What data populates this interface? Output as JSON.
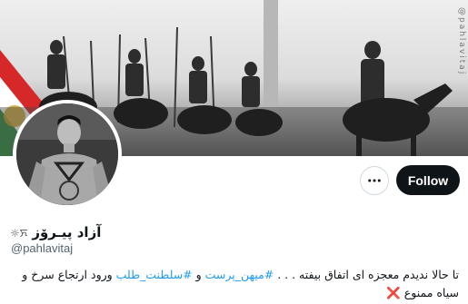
{
  "banner": {
    "watermark": "@pahlavitaj",
    "image_description_icon": "mounted-cavalry-parade-photo"
  },
  "profile": {
    "display_name": "آزاد پیـرۆز",
    "name_emoji": "☼ꯈ",
    "handle": "@pahlavitaj",
    "avatar_icon": "profile-photo"
  },
  "actions": {
    "more_icon": "more-horizontal-icon",
    "follow_label": "Follow"
  },
  "bio": {
    "text_before": "تا حالا ندیدم معجزه ای اتفاق بیفته . . . ",
    "hashtag1": "#میهن_پرست",
    "joiner": " و ",
    "hashtag2": "#سلطنت_طلب",
    "text_after": " ورود ارتجاع سرخ و سیاه ممنوع ",
    "cross": "❌"
  },
  "colors": {
    "follow_bg": "#0f1419",
    "link": "#1d9bf0",
    "handle": "#536471",
    "flag_red": "#d62828",
    "flag_green": "#2e8b3e"
  }
}
